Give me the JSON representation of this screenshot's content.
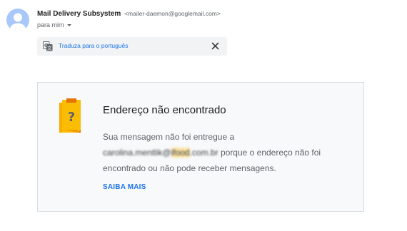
{
  "header": {
    "sender_name": "Mail Delivery Subsystem",
    "sender_email": "<mailer-daemon@googlemail.com>",
    "recipient_label": "para mim",
    "avatar_color": "#a8c7fa"
  },
  "translate_bar": {
    "icon": "translate-icon",
    "link_label": "Traduza para o português",
    "close_icon": "close-icon"
  },
  "bounce_card": {
    "icon": "document-question-icon",
    "icon_color": "#f9ab00",
    "title": "Endereço não encontrado",
    "body_prefix": "Sua mensagem não foi entregue a",
    "email_user": "carolina.mentlik@",
    "email_domain_highlight": "ifood",
    "email_domain_rest": ".com.br",
    "body_suffix": "porque o endereço não foi encontrado ou não pode receber mensagens.",
    "learn_more_label": "SAIBA MAIS"
  },
  "colors": {
    "link_blue": "#1a73e8",
    "card_background": "#f8f9fa",
    "card_border": "#dadce0"
  }
}
